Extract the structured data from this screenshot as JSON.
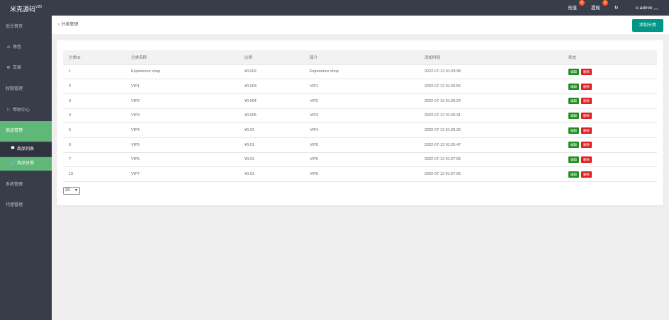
{
  "header": {
    "logo_text": "米克源码",
    "logo_version": "V20",
    "recharge_label": "充值",
    "recharge_badge": "0",
    "withdraw_label": "提现",
    "withdraw_badge": "0",
    "refresh_icon": "refresh-icon",
    "user_label": "admin"
  },
  "sidebar": {
    "items": [
      {
        "label": "后台首页"
      },
      {
        "label": "角色"
      },
      {
        "label": "交易"
      },
      {
        "label": "权限管理"
      },
      {
        "label": "帮助中心"
      },
      {
        "label": "商品管理"
      },
      {
        "label": "商品列表"
      },
      {
        "label": "商品分类"
      },
      {
        "label": "系统管理"
      },
      {
        "label": "代理管理"
      }
    ]
  },
  "breadcrumb": {
    "current": "分类管理"
  },
  "toolbar": {
    "add_label": "添加分类"
  },
  "table": {
    "columns": [
      "分类ID",
      "分类名称",
      "比例",
      "简介",
      "添加时间",
      "状态"
    ],
    "edit_label": "编辑",
    "delete_label": "删除",
    "rows": [
      {
        "id": "1",
        "name": "Experience shop",
        "ratio": "¥0.002",
        "intro": "Experience shop",
        "time": "2022-07-12 01:29:38"
      },
      {
        "id": "2",
        "name": "VIP1",
        "ratio": "¥0.003",
        "intro": "VIP1",
        "time": "2022-07-12 01:26:56"
      },
      {
        "id": "3",
        "name": "VIP2",
        "ratio": "¥0.004",
        "intro": "VIP2",
        "time": "2022-07-12 01:26:24"
      },
      {
        "id": "4",
        "name": "VIP3",
        "ratio": "¥0.005",
        "intro": "VIP3",
        "time": "2022-07-12 01:26:31"
      },
      {
        "id": "5",
        "name": "VIP4",
        "ratio": "¥0.01",
        "intro": "VIP4",
        "time": "2022-07-12 01:26:39"
      },
      {
        "id": "6",
        "name": "VIP5",
        "ratio": "¥0.01",
        "intro": "VIP5",
        "time": "2022-07-12 01:26:47"
      },
      {
        "id": "7",
        "name": "VIP6",
        "ratio": "¥0.01",
        "intro": "VIP6",
        "time": "2022-07-12 01:27:06"
      },
      {
        "id": "10",
        "name": "VIP7",
        "ratio": "¥0.01",
        "intro": "VIP6",
        "time": "2022-07-12 01:27:06"
      }
    ]
  },
  "pagination": {
    "page_size": "20"
  },
  "colors": {
    "topbar": "#393d49",
    "active_nav": "#5fb878",
    "add_button": "#009688",
    "edit_button": "#1e8f1e",
    "delete_button": "#e02020",
    "badge": "#ff5722"
  }
}
